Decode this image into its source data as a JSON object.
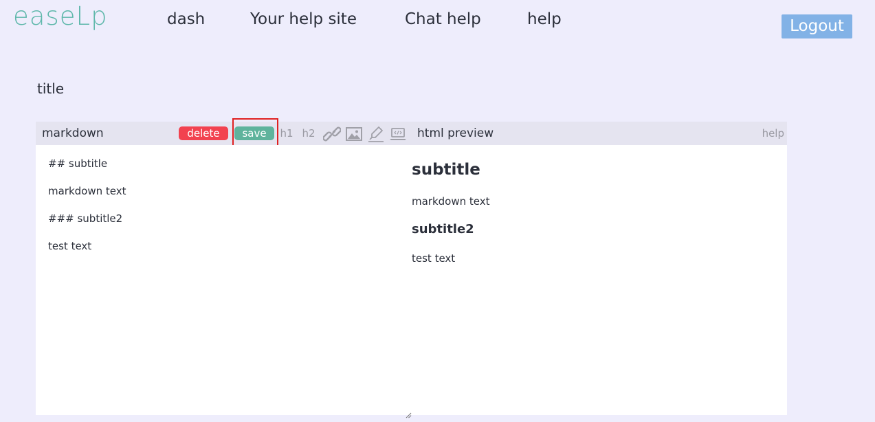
{
  "brand": {
    "logo": "easeLp",
    "color": "#5fb8ab"
  },
  "nav": {
    "items": [
      {
        "label": "dash"
      },
      {
        "label": "Your help site"
      },
      {
        "label": "Chat help"
      },
      {
        "label": "help"
      }
    ],
    "logout_label": "Logout"
  },
  "document": {
    "title": "title"
  },
  "toolbar": {
    "markdown_label": "markdown",
    "delete_label": "delete",
    "save_label": "save",
    "h1_label": "h1",
    "h2_label": "h2",
    "icons": [
      "link-icon",
      "image-icon",
      "highlighter-icon",
      "code-laptop-icon"
    ],
    "preview_label": "html preview",
    "help_label": "help",
    "colors": {
      "delete": "#f2424f",
      "save": "#5fb39c"
    }
  },
  "editor": {
    "lines": [
      "## subtitle",
      "markdown text",
      "### subtitle2",
      "test text"
    ]
  },
  "preview": {
    "h2": "subtitle",
    "p1": "markdown text",
    "h3": "subtitle2",
    "p2": "test text"
  }
}
